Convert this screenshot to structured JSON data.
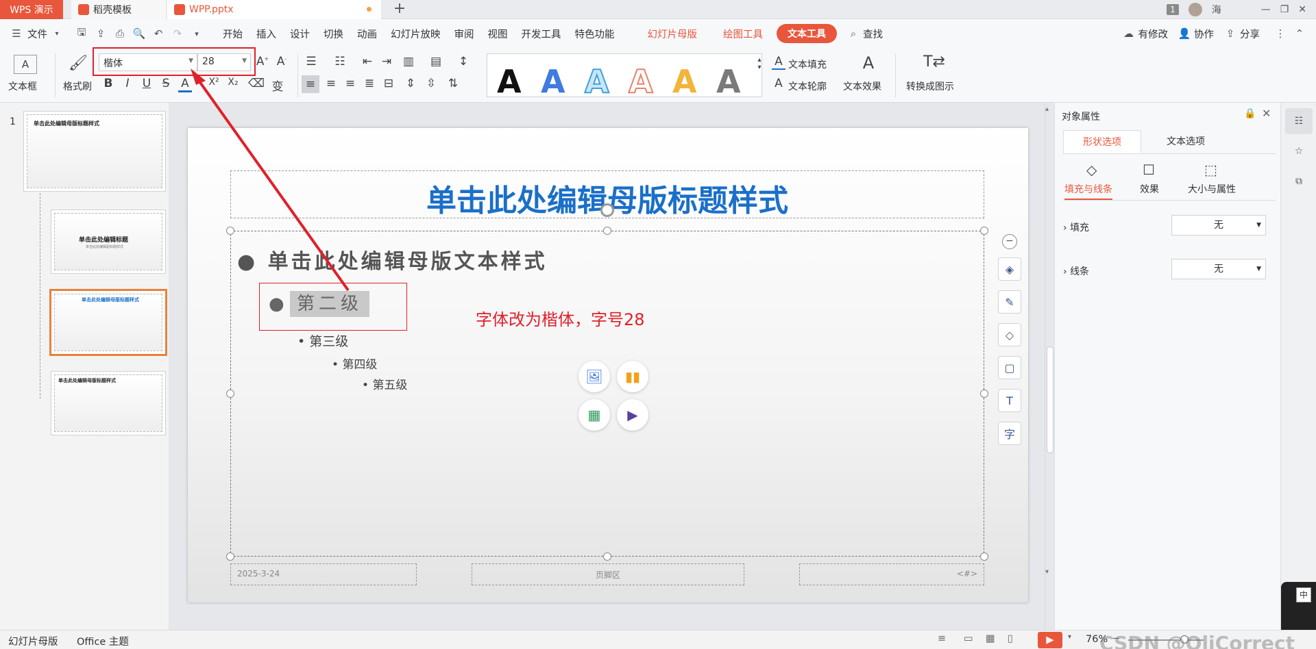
{
  "tabs": {
    "wps": "WPS 演示",
    "template": "稻壳模板",
    "file": "WPP.pptx",
    "add": "+"
  },
  "window": {
    "badge": "1",
    "user": "海"
  },
  "menu": {
    "file": "文件",
    "items": [
      "开始",
      "插入",
      "设计",
      "切换",
      "动画",
      "幻灯片放映",
      "审阅",
      "视图",
      "开发工具",
      "特色功能"
    ],
    "context": [
      "幻灯片母版",
      "绘图工具"
    ],
    "active": "文本工具",
    "search": "查找",
    "modified": "有修改",
    "collab": "协作",
    "share": "分享"
  },
  "ribbon": {
    "textbox": "文本框",
    "format_painter": "格式刷",
    "font_name": "楷体",
    "font_size": "28",
    "text_fill": "文本填充",
    "text_outline": "文本轮廓",
    "text_effect": "文本效果",
    "convert": "转换成图示",
    "style_letter": "A"
  },
  "slide_thumbs": {
    "number": "1",
    "master_title": "单击此处编辑母版标题样式",
    "layout_title": "单击此处编辑标题",
    "layout_sub": "单击此处编辑副标题样式"
  },
  "slide": {
    "title": "单击此处编辑母版标题样式",
    "level1": "单击此处编辑母版文本样式",
    "level2": "第二级",
    "level3": "第三级",
    "level4": "第四级",
    "level5": "第五级",
    "annotation": "字体改为楷体，字号28",
    "footer_date": "2025-3-24",
    "footer_center": "页脚区",
    "footer_num": "<#>"
  },
  "props": {
    "title": "对象属性",
    "tab_shape": "形状选项",
    "tab_text": "文本选项",
    "sub_fill_line": "填充与线条",
    "sub_effect": "效果",
    "sub_size": "大小与属性",
    "fill_label": "填充",
    "fill_value": "无",
    "line_label": "线条",
    "line_value": "无"
  },
  "status": {
    "mode": "幻灯片母版",
    "theme": "Office 主题",
    "zoom": "76%",
    "watermark": "CSDN @OliCorrect"
  },
  "colors": {
    "accent": "#e8573b",
    "title_blue": "#1a6fc9",
    "annotation_red": "#e0202a"
  }
}
